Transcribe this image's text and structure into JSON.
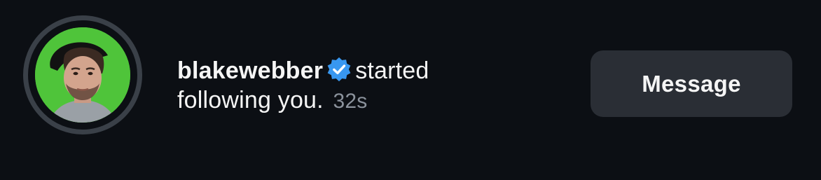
{
  "notification": {
    "username": "blakewebber",
    "action_text": "started following you.",
    "time": "32s",
    "verified_icon": "verified-badge-icon",
    "avatar_icon": "profile-avatar"
  },
  "actions": {
    "message_label": "Message"
  },
  "colors": {
    "background": "#0c0f14",
    "button_bg": "#2a2e35",
    "verified_blue": "#3897f0",
    "secondary_text": "#8b929c",
    "avatar_bg": "#4fc43a"
  }
}
